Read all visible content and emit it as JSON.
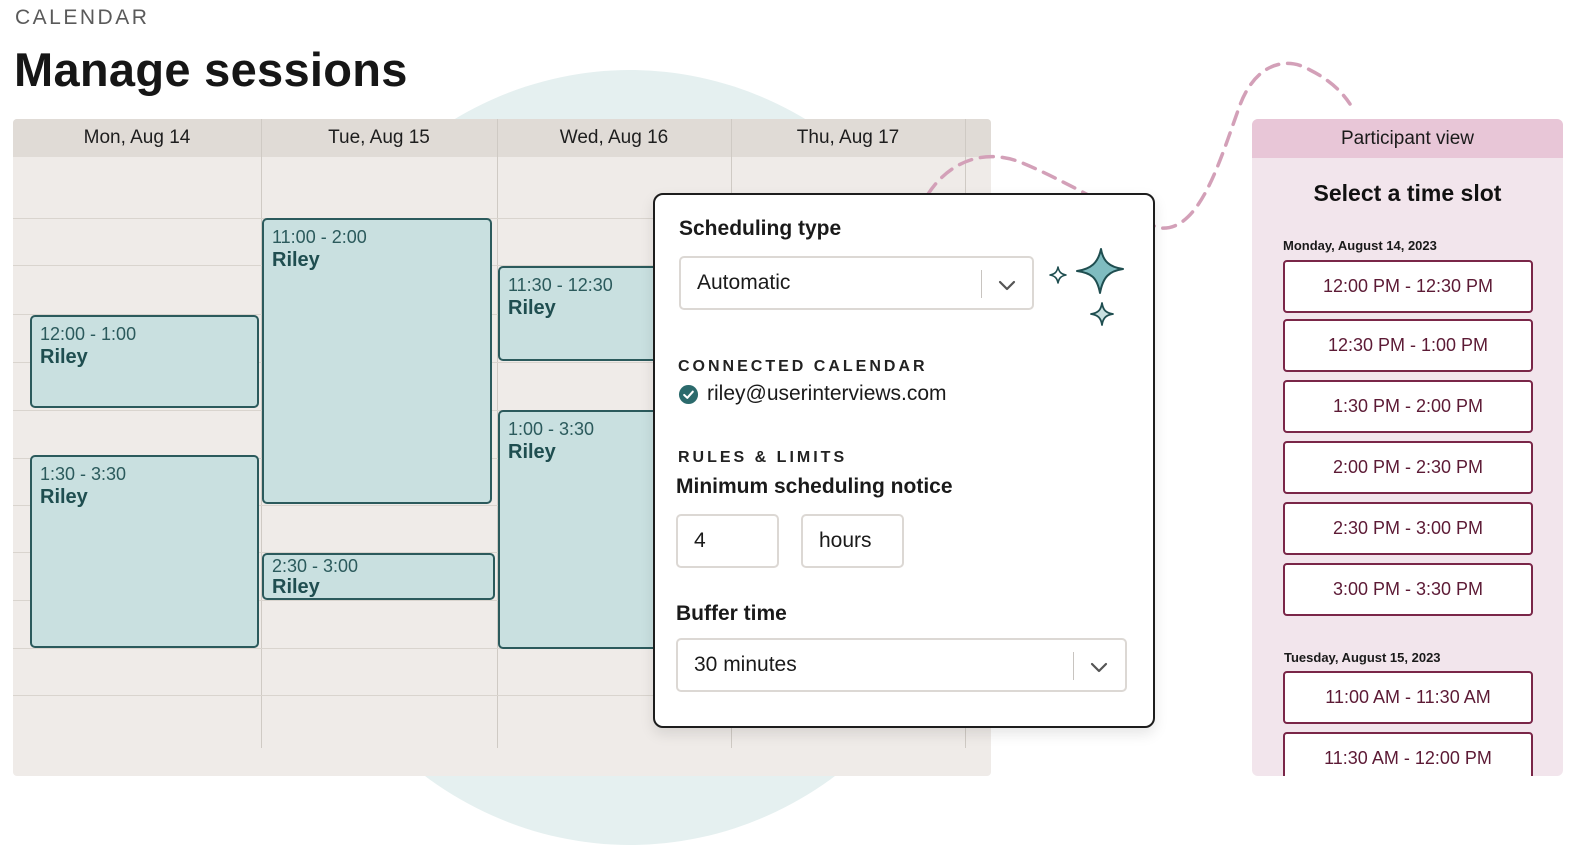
{
  "header": {
    "eyebrow": "CALENDAR",
    "title": "Manage sessions"
  },
  "calendar": {
    "days": [
      "Mon, Aug 14",
      "Tue, Aug 15",
      "Wed, Aug 16",
      "Thu, Aug 17"
    ],
    "events": [
      {
        "day": "Mon, Aug 14",
        "time": "12:00 - 1:00",
        "name": "Riley"
      },
      {
        "day": "Mon, Aug 14",
        "time": "1:30 - 3:30",
        "name": "Riley"
      },
      {
        "day": "Tue, Aug 15",
        "time": "11:00 - 2:00",
        "name": "Riley"
      },
      {
        "day": "Tue, Aug 15",
        "time": "2:30 - 3:00",
        "name": "Riley"
      },
      {
        "day": "Wed, Aug 16",
        "time": "11:30 - 12:30",
        "name": "Riley"
      },
      {
        "day": "Wed, Aug 16",
        "time": "1:00 - 3:30",
        "name": "Riley"
      }
    ]
  },
  "settings": {
    "scheduling_type_label": "Scheduling type",
    "scheduling_type_value": "Automatic",
    "connected_calendar_label": "CONNECTED CALENDAR",
    "connected_email": "riley@userinterviews.com",
    "rules_label": "RULES & LIMITS",
    "min_notice_label": "Minimum scheduling notice",
    "min_notice_value": "4",
    "min_notice_unit": "hours",
    "buffer_label": "Buffer time",
    "buffer_value": "30 minutes"
  },
  "participant": {
    "header": "Participant view",
    "title": "Select a time slot",
    "groups": [
      {
        "date": "Monday, August 14, 2023",
        "slots": [
          "12:00 PM - 12:30 PM",
          "12:30 PM - 1:00 PM",
          "1:30 PM - 2:00 PM",
          "2:00 PM - 2:30 PM",
          "2:30 PM - 3:00 PM",
          "3:00 PM - 3:30 PM"
        ]
      },
      {
        "date": "Tuesday, August 15, 2023",
        "slots": [
          "11:00 AM - 11:30 AM",
          "11:30 AM - 12:00 PM"
        ]
      }
    ]
  },
  "colors": {
    "event_fill": "#c9e0e0",
    "event_border": "#2b5a5c",
    "slot_border": "#7a2648",
    "participant_bg": "#f2e5ec",
    "participant_header": "#e8c6d7",
    "dashed_line": "#d3a0b8",
    "check_icon": "#2b6a6c"
  },
  "icons": [
    "chevron-down-icon",
    "check-circle-icon",
    "sparkle-icon"
  ]
}
